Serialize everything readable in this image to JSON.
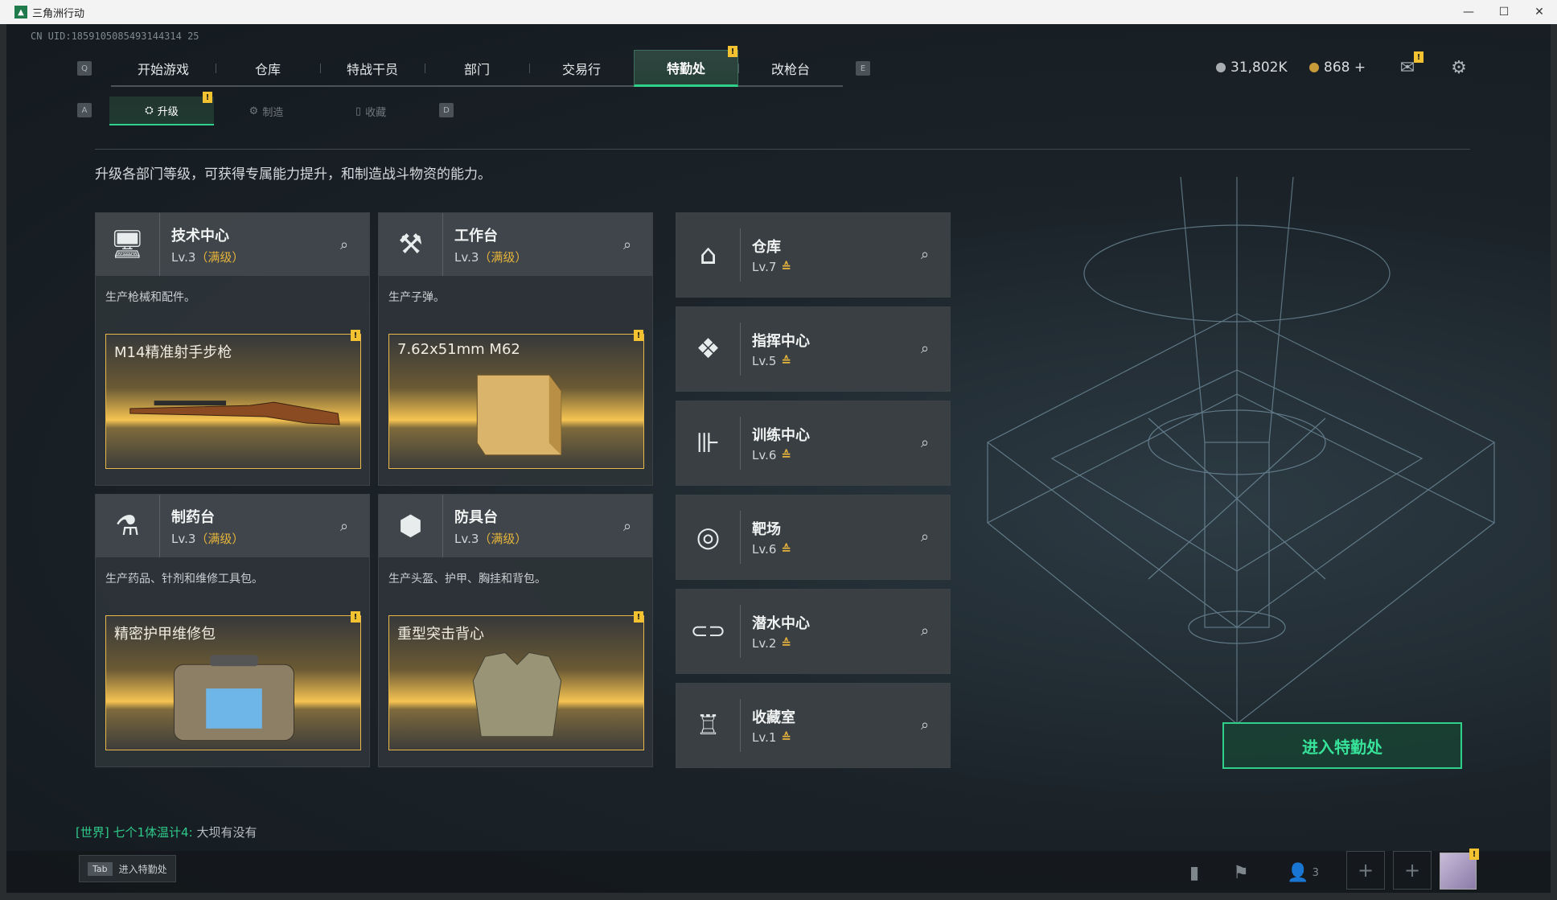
{
  "window": {
    "title": "三角洲行动",
    "min": "—",
    "max": "☐",
    "close": "✕"
  },
  "uid": "CN UID:1859105085493144314 25",
  "keys": {
    "q": "Q",
    "e": "E",
    "a": "A",
    "d": "D"
  },
  "topnav": [
    {
      "label": "开始游戏"
    },
    {
      "label": "仓库"
    },
    {
      "label": "特战干员"
    },
    {
      "label": "部门"
    },
    {
      "label": "交易行"
    },
    {
      "label": "特勤处",
      "active": true
    },
    {
      "label": "改枪台"
    }
  ],
  "badge_mark": "!",
  "currency": {
    "silver": "31,802K",
    "gold": "868 +"
  },
  "subnav": [
    {
      "label": "升级",
      "icon": "⛭",
      "active": true
    },
    {
      "label": "制造",
      "icon": "⚙"
    },
    {
      "label": "收藏",
      "icon": "▯"
    }
  ],
  "description": "升级各部门等级，可获得专属能力提升，和制造战斗物资的能力。",
  "big_cards": [
    {
      "icon": "computer-icon",
      "glyph": "🖥",
      "title": "技术中心",
      "lv": "Lv.3",
      "max": "（满级）",
      "info": "生产枪械和配件。",
      "product": "M14精准射手步枪",
      "art": "rifle"
    },
    {
      "icon": "tools-icon",
      "glyph": "⚒",
      "title": "工作台",
      "lv": "Lv.3",
      "max": "（满级）",
      "info": "生产子弹。",
      "product": "7.62x51mm M62",
      "art": "ammo-box"
    },
    {
      "icon": "flask-icon",
      "glyph": "⚗",
      "title": "制药台",
      "lv": "Lv.3",
      "max": "（满级）",
      "info": "生产药品、针剂和维修工具包。",
      "product": "精密护甲维修包",
      "art": "repair-kit"
    },
    {
      "icon": "armor-icon",
      "glyph": "⬢",
      "title": "防具台",
      "lv": "Lv.3",
      "max": "（满级）",
      "info": "生产头盔、护甲、胸挂和背包。",
      "product": "重型突击背心",
      "art": "vest"
    }
  ],
  "small_cards": [
    {
      "icon": "warehouse-icon",
      "glyph": "⌂",
      "title": "仓库",
      "lv": "Lv.7"
    },
    {
      "icon": "command-icon",
      "glyph": "❖",
      "title": "指挥中心",
      "lv": "Lv.5"
    },
    {
      "icon": "dumbbell-icon",
      "glyph": "⊪",
      "title": "训练中心",
      "lv": "Lv.6"
    },
    {
      "icon": "target-icon",
      "glyph": "◎",
      "title": "靶场",
      "lv": "Lv.6"
    },
    {
      "icon": "diving-mask-icon",
      "glyph": "⊂⊃",
      "title": "潜水中心",
      "lv": "Lv.2"
    },
    {
      "icon": "trophy-icon",
      "glyph": "♖",
      "title": "收藏室",
      "lv": "Lv.1"
    }
  ],
  "upgrade_mark": "≙",
  "search_glyph": "⌕",
  "enter_button": "进入特勤处",
  "chat": {
    "channel": "[世界]",
    "sender": "七个1体温计4:",
    "message": "大坝有没有"
  },
  "tab_hint": {
    "key": "Tab",
    "label": "进入特勤处"
  },
  "bottom": {
    "friends_count": "3"
  },
  "colors": {
    "accent": "#2fd08a",
    "gold": "#e6b43c",
    "badge": "#f2c230"
  }
}
